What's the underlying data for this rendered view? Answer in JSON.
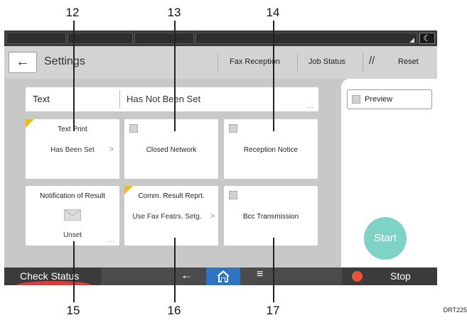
{
  "callouts": {
    "c12": "12",
    "c13": "13",
    "c14": "14",
    "c15": "15",
    "c16": "16",
    "c17": "17"
  },
  "figure_id": "DRT225",
  "header": {
    "back_icon": "←",
    "title": "Settings",
    "fax_reception": "Fax Reception",
    "job_status": "Job Status",
    "reset_icon": "//",
    "reset": "Reset"
  },
  "text_row": {
    "label": "Text",
    "value": "Has Not Been Set",
    "more": "..."
  },
  "tiles": [
    {
      "title": "Text Print",
      "value": "Has Been Set",
      "chev": ">"
    },
    {
      "title": "Closed Network"
    },
    {
      "title": "Reception Notice"
    },
    {
      "title": "Notification of Result",
      "value": "Unset",
      "icon": "mail-icon",
      "more": "..."
    },
    {
      "title": "Comm. Result Reprt.",
      "value": "Use Fax Featrs. Setg.",
      "chev": ">"
    },
    {
      "title": "Bcc Transmission"
    }
  ],
  "right_panel": {
    "preview": "Preview",
    "start": "Start"
  },
  "bottom_bar": {
    "check_status": "Check Status",
    "back_glyph": "←",
    "menu_glyph": "≡",
    "stop": "Stop"
  },
  "status_strip": {
    "moon": "☾",
    "corner": "◢"
  },
  "colors": {
    "start": "#7fd2c6",
    "home": "#2e74c5",
    "stop": "#e8553a",
    "flag": "#f0b822",
    "check_status_arc": "#e23a3a"
  }
}
